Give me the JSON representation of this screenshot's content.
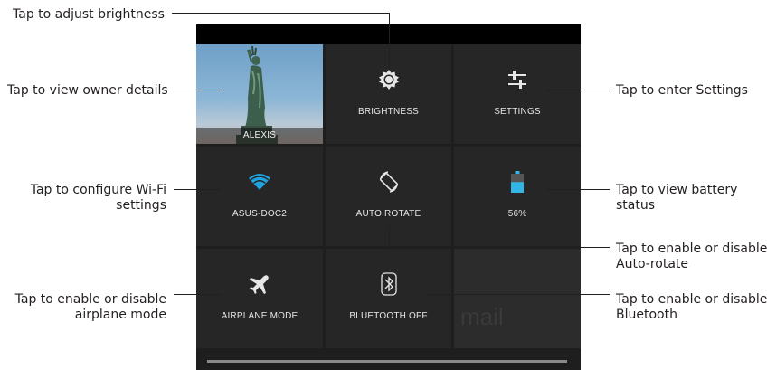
{
  "callouts": {
    "brightness": "Tap to adjust brightness",
    "owner": "Tap to view owner details",
    "settings": "Tap to enter Settings",
    "wifi_line1": "Tap to configure Wi-Fi",
    "wifi_line2": "settings",
    "battery_line1": "Tap to view battery",
    "battery_line2": "status",
    "autorotate_line1": "Tap to enable or disable",
    "autorotate_line2": "Auto-rotate",
    "airplane_line1": "Tap to enable or disable",
    "airplane_line2": "airplane mode",
    "bluetooth_line1": "Tap to enable or disable",
    "bluetooth_line2": "Bluetooth"
  },
  "tiles": {
    "owner": "ALEXIS",
    "brightness": "BRIGHTNESS",
    "settings": "SETTINGS",
    "wifi": "ASUS-DOC2",
    "autorotate": "AUTO ROTATE",
    "battery": "56%",
    "airplane": "AIRPLANE MODE",
    "bluetooth": "BLUETOOTH OFF"
  },
  "background_text": "mail",
  "battery_level": 0.56,
  "colors": {
    "wifi": "#1fa3e0",
    "battery": "#33b5e5",
    "panel": "#1e1e1e"
  }
}
